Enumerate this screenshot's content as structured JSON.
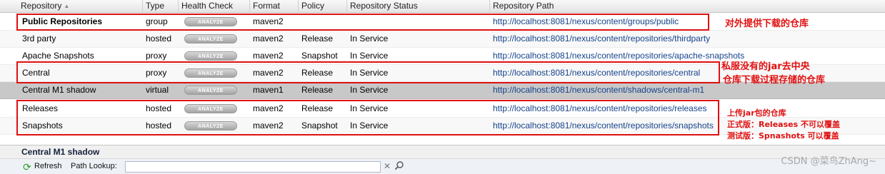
{
  "columns": [
    "Repository",
    "Type",
    "Health Check",
    "Format",
    "Policy",
    "Repository Status",
    "Repository Path"
  ],
  "analyze_label": "ANALYZE",
  "rows": [
    {
      "name": "Public Repositories",
      "type": "group",
      "format": "maven2",
      "policy": "",
      "status": "",
      "path": "http://localhost:8081/nexus/content/groups/public"
    },
    {
      "name": "3rd party",
      "type": "hosted",
      "format": "maven2",
      "policy": "Release",
      "status": "In Service",
      "path": "http://localhost:8081/nexus/content/repositories/thirdparty"
    },
    {
      "name": "Apache Snapshots",
      "type": "proxy",
      "format": "maven2",
      "policy": "Snapshot",
      "status": "In Service",
      "path": "http://localhost:8081/nexus/content/repositories/apache-snapshots"
    },
    {
      "name": "Central",
      "type": "proxy",
      "format": "maven2",
      "policy": "Release",
      "status": "In Service",
      "path": "http://localhost:8081/nexus/content/repositories/central"
    },
    {
      "name": "Central M1 shadow",
      "type": "virtual",
      "format": "maven1",
      "policy": "Release",
      "status": "In Service",
      "path": "http://localhost:8081/nexus/content/shadows/central-m1"
    },
    {
      "name": "Releases",
      "type": "hosted",
      "format": "maven2",
      "policy": "Release",
      "status": "In Service",
      "path": "http://localhost:8081/nexus/content/repositories/releases"
    },
    {
      "name": "Snapshots",
      "type": "hosted",
      "format": "maven2",
      "policy": "Snapshot",
      "status": "In Service",
      "path": "http://localhost:8081/nexus/content/repositories/snapshots"
    }
  ],
  "annotations": {
    "group_note": "对外提供下载的仓库",
    "proxy_note_line1": "私服没有的jar去中央",
    "proxy_note_line2": "仓库下载过程存储的仓库",
    "hosted_note_line1": "上传jar包的仓库",
    "hosted_note_line2": "正式版：Releases 不可以覆盖",
    "hosted_note_line3": "测试版：Spnashots 可以覆盖",
    "color": "#e01010"
  },
  "detail_title": "Central M1 shadow",
  "toolbar": {
    "refresh_label": "Refresh",
    "path_lookup_label": "Path Lookup:",
    "path_lookup_value": ""
  },
  "watermark": "CSDN @菜鸟ZhAng~"
}
